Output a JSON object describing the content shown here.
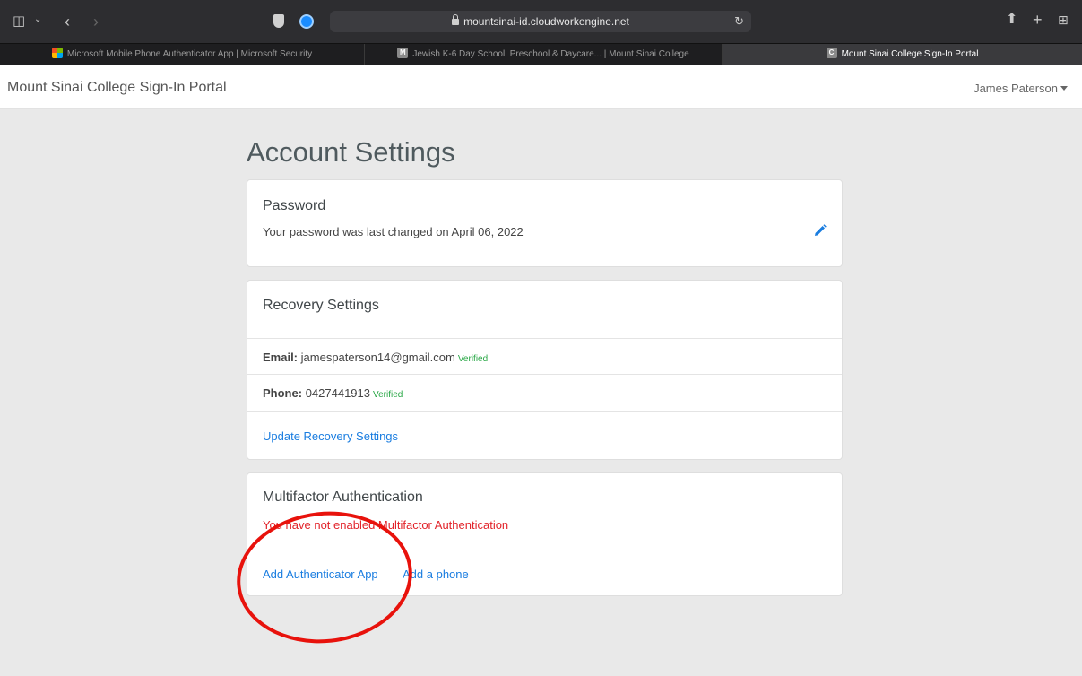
{
  "browser": {
    "address": "mountsinai-id.cloudworkengine.net",
    "tabs": [
      {
        "label": "Microsoft Mobile Phone Authenticator App | Microsoft Security",
        "favicon": "microsoft-logo",
        "active": false
      },
      {
        "label": "Jewish K-6 Day School, Preschool & Daycare... | Mount Sinai College",
        "favicon_letter": "M",
        "active": false
      },
      {
        "label": "Mount Sinai College Sign-In Portal",
        "favicon_letter": "C",
        "active": true
      }
    ]
  },
  "header": {
    "brand": "Mount Sinai College Sign-In Portal",
    "user": "James Paterson"
  },
  "main": {
    "title": "Account Settings",
    "password": {
      "title": "Password",
      "text": "Your password was last changed on April 06, 2022"
    },
    "recovery": {
      "title": "Recovery Settings",
      "email_label": "Email:",
      "email": "jamespaterson14@gmail.com",
      "email_status": "Verified",
      "phone_label": "Phone:",
      "phone": "0427441913",
      "phone_status": "Verified",
      "update_link": "Update Recovery Settings"
    },
    "mfa": {
      "title": "Multifactor Authentication",
      "warning": "You have not enabled Multifactor Authentication",
      "add_app": "Add Authenticator App",
      "add_phone": "Add a phone"
    }
  },
  "colors": {
    "link": "#1a7de0",
    "verified": "#28a745",
    "warning": "#e2232a",
    "annotation": "#e8120c"
  }
}
